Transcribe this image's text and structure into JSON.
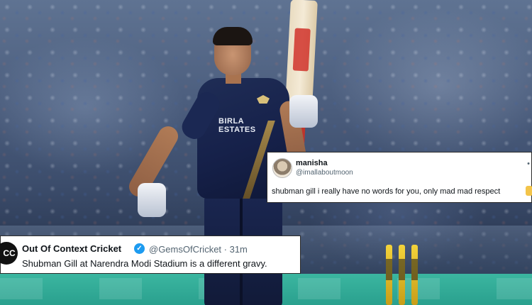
{
  "tweets": {
    "top": {
      "display_name": "manisha",
      "handle": "@imallaboutmoon",
      "text": "shubman gill i really have no words for you, only mad mad respect"
    },
    "bottom": {
      "avatar_text": "CC",
      "display_name": "Out Of Context Cricket",
      "handle_time": "@GemsOfCricket · 31m",
      "text": "Shubman Gill at Narendra Modi Stadium is a different gravy."
    }
  },
  "photo": {
    "jersey_sponsor": "BIRLA ESTATES",
    "icons": [
      "verified-badge-icon",
      "more-icon",
      "emoji-icon"
    ]
  },
  "colors": {
    "verified": "#1d9bf0",
    "jersey": "#1a2650",
    "board": "#2aa08e"
  }
}
